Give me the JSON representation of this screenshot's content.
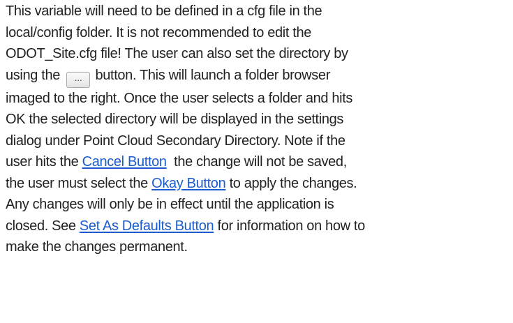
{
  "doc": {
    "line1": "This variable will need to be defined in a cfg file in the",
    "line2": "local/config folder. It is not recommended to edit the",
    "line3": "ODOT_Site.cfg file! The user can also set the directory by",
    "line4_before": "using the ",
    "browse_button_glyph": "...",
    "line4_after": " button. This will launch a folder browser",
    "line5": "imaged to the right. Once the user selects a folder and hits",
    "line6": "OK the selected directory will be displayed in the settings",
    "line7": "dialog under Point Cloud Secondary Directory. Note if the",
    "line8_before": "user hits the ",
    "cancel_link": "Cancel Button",
    "line8_after": "  the change will not be saved,",
    "line9_before": "the user must select the ",
    "okay_link": "Okay Button",
    "line9_after": " to apply the changes.",
    "line10": "Any changes will only be in effect until the application is",
    "line11_before": "closed. See ",
    "defaults_link": "Set As Defaults Button",
    "line11_after": " for information on how to",
    "line12": "make the changes permanent."
  },
  "colors": {
    "text": "#222222",
    "link": "#1a5ccd",
    "background": "#ffffff"
  }
}
